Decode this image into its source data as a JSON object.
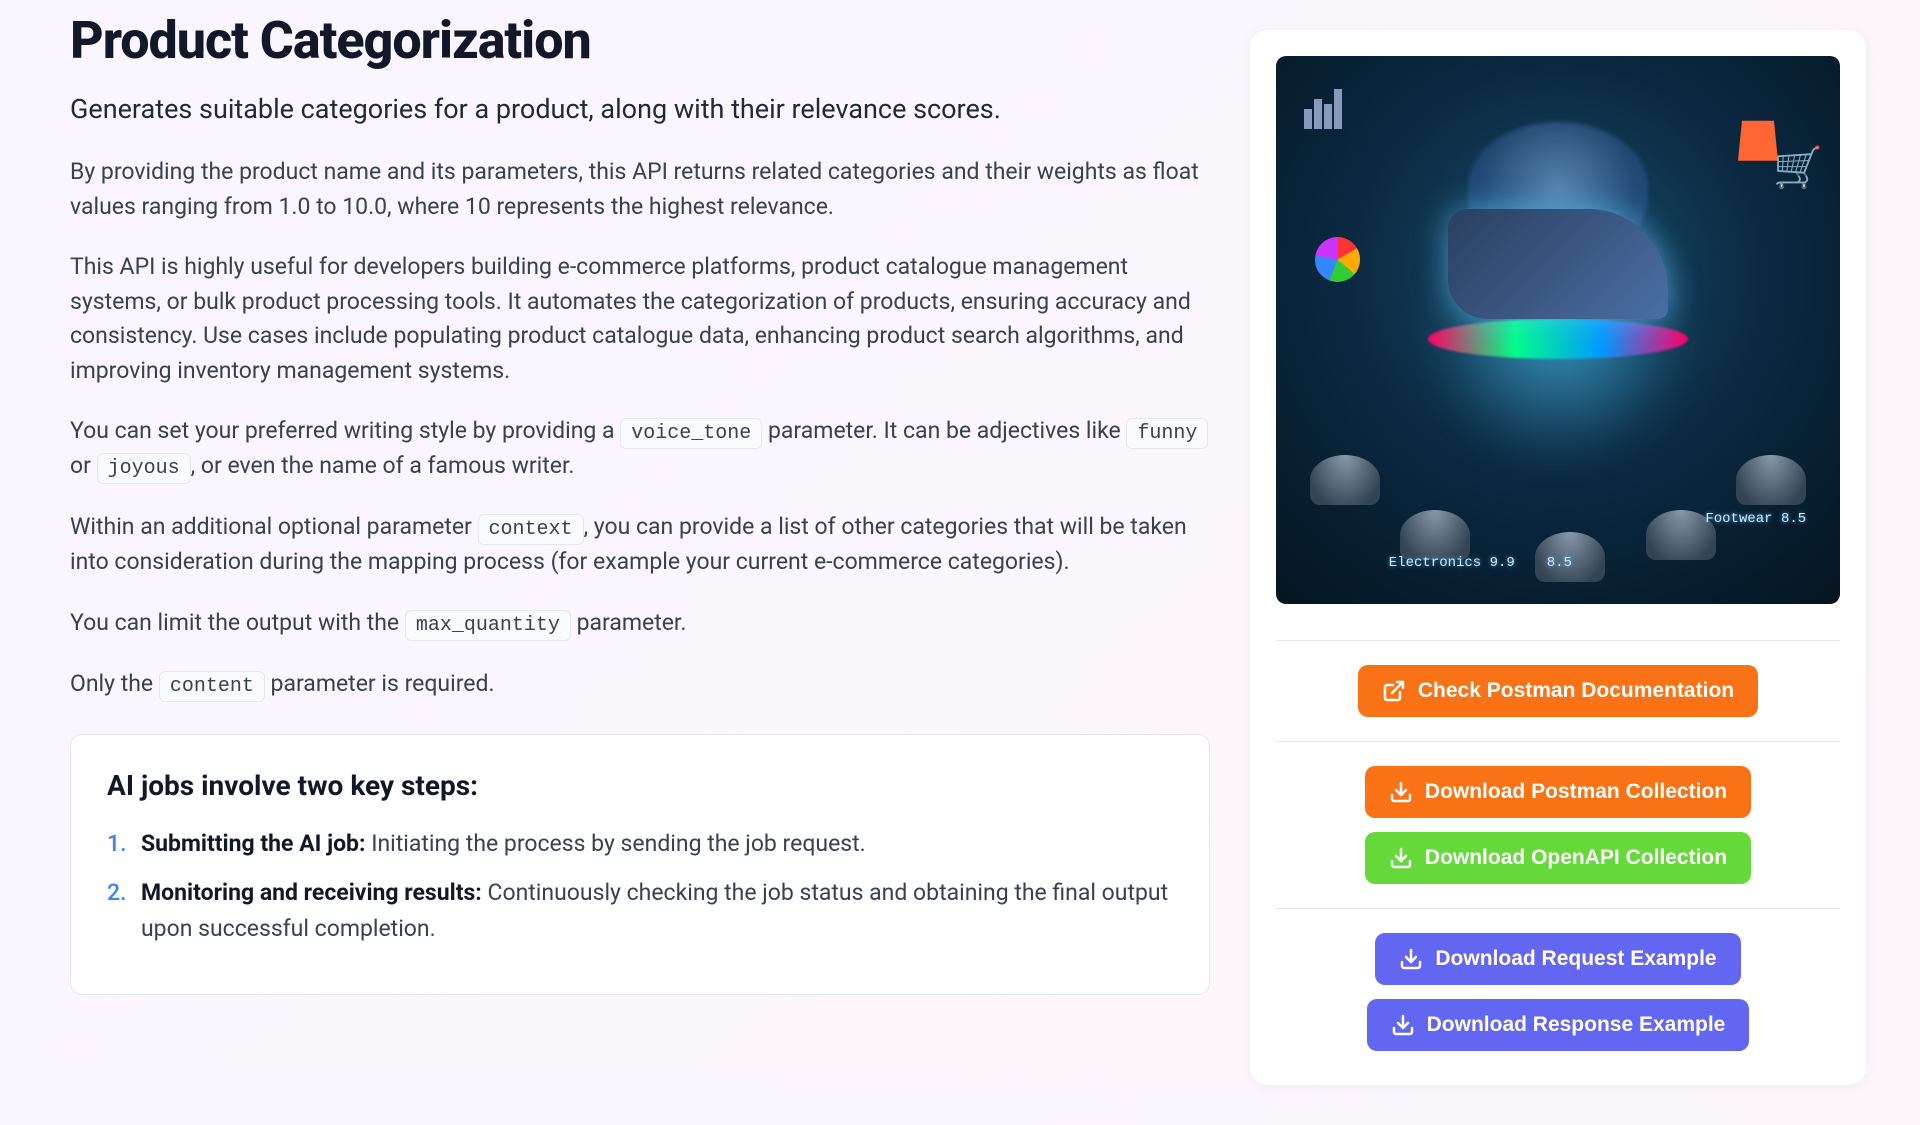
{
  "page": {
    "title": "Product Categorization",
    "subtitle": "Generates suitable categories for a product, along with their relevance scores."
  },
  "paragraphs": {
    "p1": "By providing the product name and its parameters, this API returns related categories and their weights as float values ranging from 1.0 to 10.0, where 10 represents the highest relevance.",
    "p2": "This API is highly useful for developers building e-commerce platforms, product catalogue management systems, or bulk product processing tools. It automates the categorization of products, ensuring accuracy and consistency. Use cases include populating product catalogue data, enhancing product search algorithms, and improving inventory management systems.",
    "p3_a": "You can set your preferred writing style by providing a ",
    "p3_code1": "voice_tone",
    "p3_b": " parameter. It can be adjectives like ",
    "p3_code2": "funny",
    "p3_c": " or ",
    "p3_code3": "joyous",
    "p3_d": ", or even the name of a famous writer.",
    "p4_a": "Within an additional optional parameter ",
    "p4_code1": "context",
    "p4_b": ", you can provide a list of other categories that will be taken into consideration during the mapping process (for example your current e-commerce categories).",
    "p5_a": "You can limit the output with the ",
    "p5_code1": "max_quantity",
    "p5_b": " parameter.",
    "p6_a": "Only the ",
    "p6_code1": "content",
    "p6_b": " parameter is required."
  },
  "steps_card": {
    "heading": "AI jobs involve two key steps:",
    "items": [
      {
        "bold": "Submitting the AI job:",
        "rest": " Initiating the process by sending the job request."
      },
      {
        "bold": "Monitoring and receiving results:",
        "rest": " Continuously checking the job status and obtaining the final output upon successful completion."
      }
    ]
  },
  "hero_labels": {
    "l1": "Electronics 9.9",
    "l2": "8.5",
    "l3": "Footwear 8.5"
  },
  "buttons": {
    "check_postman": "Check Postman Documentation",
    "dl_postman": "Download Postman Collection",
    "dl_openapi": "Download OpenAPI Collection",
    "dl_request": "Download Request Example",
    "dl_response": "Download Response Example"
  }
}
